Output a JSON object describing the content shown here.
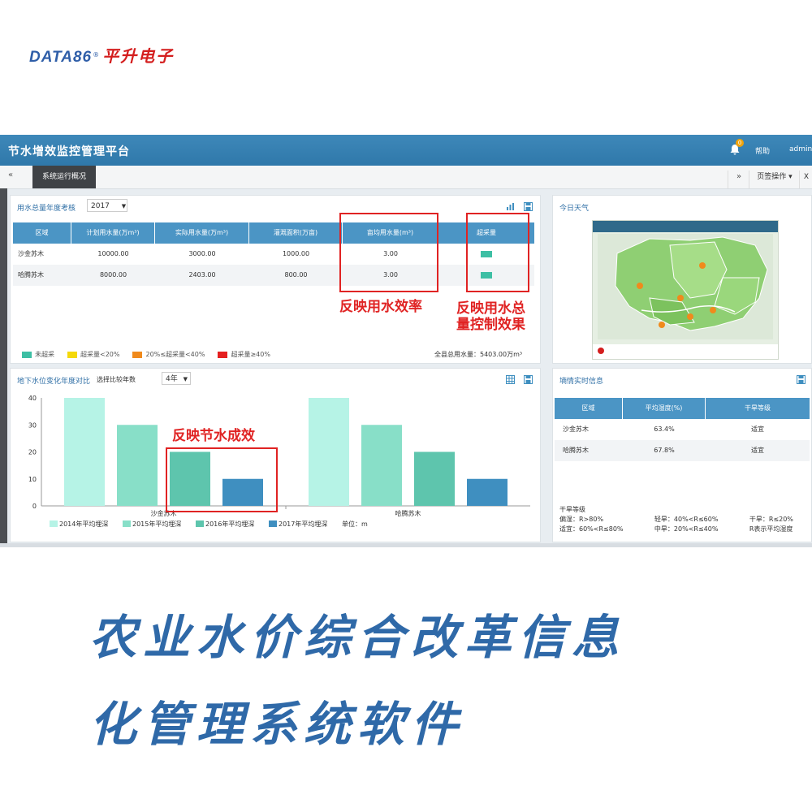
{
  "brand": {
    "name_en": "DATA86",
    "reg": "®",
    "name_cn": "平升电子"
  },
  "app": {
    "title": "节水增效监控管理平台",
    "notification_count": "0",
    "help": "帮助",
    "user": "admin",
    "tabs": {
      "prev": "«",
      "active": "系统运行概况",
      "next": "»",
      "page_ops": "页签操作 ▾",
      "close": "X"
    }
  },
  "water_panel": {
    "title": "用水总量年度考核",
    "year": "2017",
    "headers": [
      "区域",
      "计划用水量(万m³)",
      "实际用水量(万m³)",
      "灌溉面积(万亩)",
      "亩均用水量(m³)",
      "超采量"
    ],
    "rows": [
      [
        "沙金苏木",
        "10000.00",
        "3000.00",
        "1000.00",
        "3.00"
      ],
      [
        "哈腾苏木",
        "8000.00",
        "2403.00",
        "800.00",
        "3.00"
      ]
    ],
    "legend": [
      {
        "label": "未超采",
        "color": "#3ebfa4"
      },
      {
        "label": "超采量<20%",
        "color": "#f5d90a"
      },
      {
        "label": "20%≤超采量<40%",
        "color": "#f08a1c"
      },
      {
        "label": "超采量≥40%",
        "color": "#e52020"
      }
    ],
    "total": "全县总用水量：5403.00万m³"
  },
  "weather_panel": {
    "title": "今日天气"
  },
  "groundwater_panel": {
    "title": "地下水位变化年度对比",
    "compare_label": "选择比较年数",
    "compare_value": "4年"
  },
  "moisture_panel": {
    "title": "墒情实时信息",
    "headers": [
      "区域",
      "平均湿度(%)",
      "干旱等级"
    ],
    "rows": [
      [
        "沙金苏木",
        "63.4%",
        "适宜"
      ],
      [
        "哈腾苏木",
        "67.8%",
        "适宜"
      ]
    ],
    "notes_title": "干旱等级",
    "notes": [
      [
        "偏湿：R>80%",
        "轻旱：40%<R≤60%",
        "干旱：R≤20%"
      ],
      [
        "适宜：60%<R≤80%",
        "中旱：20%<R≤40%",
        "R表示平均湿度"
      ]
    ]
  },
  "chart_data": {
    "type": "bar",
    "categories": [
      "沙金苏木",
      "哈腾苏木"
    ],
    "series": [
      {
        "name": "2014年平均埋深",
        "values": [
          40,
          40
        ],
        "color": "#b6f3e6"
      },
      {
        "name": "2015年平均埋深",
        "values": [
          30,
          30
        ],
        "color": "#88dfc8"
      },
      {
        "name": "2016年平均埋深",
        "values": [
          20,
          20
        ],
        "color": "#5ec5ad"
      },
      {
        "name": "2017年平均埋深",
        "values": [
          10,
          10
        ],
        "color": "#3f8fc0"
      }
    ],
    "ylim": [
      0,
      40
    ],
    "yticks": [
      0,
      10,
      20,
      30,
      40
    ],
    "unit": "单位：m"
  },
  "annotations": {
    "efficiency": "反映用水效率",
    "control_line1": "反映用水总",
    "control_line2": "量控制效果",
    "saving": "反映节水成效"
  },
  "caption": {
    "line1": "农业水价综合改革信息",
    "line2": "化管理系统软件"
  }
}
